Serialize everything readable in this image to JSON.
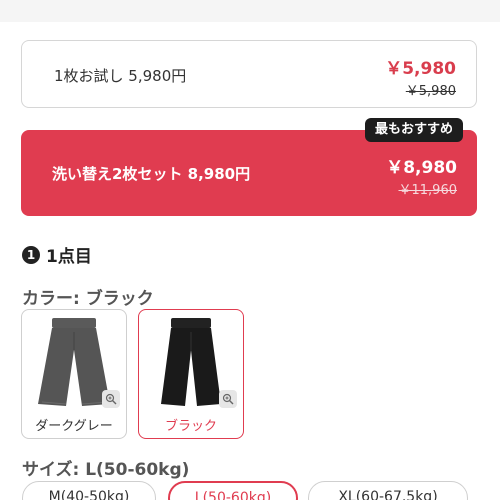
{
  "option_single": {
    "label": "1枚お試し 5,980円",
    "price": "￥5,980",
    "original_price": "￥5,980"
  },
  "option_set": {
    "badge": "最もおすすめ",
    "label": "洗い替え2枚セット 8,980円",
    "price": "￥8,980",
    "original_price": "￥11,960"
  },
  "item": {
    "number": "1",
    "title": "1点目",
    "color_label": "カラー: ブラック",
    "colors": [
      {
        "name": "ダークグレー",
        "selected": false
      },
      {
        "name": "ブラック",
        "selected": true
      }
    ],
    "size_label": "サイズ: L(50-60kg)",
    "sizes": [
      {
        "label": "M(40-50kg)",
        "selected": false
      },
      {
        "label": "L(50-60kg)",
        "selected": true
      },
      {
        "label": "XL(60-67.5kg)",
        "selected": false
      }
    ]
  },
  "colors": {
    "accent": "#e03c50",
    "badge_bg": "#1d1d1d",
    "dark_grey_product": "#555555",
    "black_product": "#1a1a1a"
  },
  "icons": {
    "zoom": "zoom-in-icon"
  }
}
